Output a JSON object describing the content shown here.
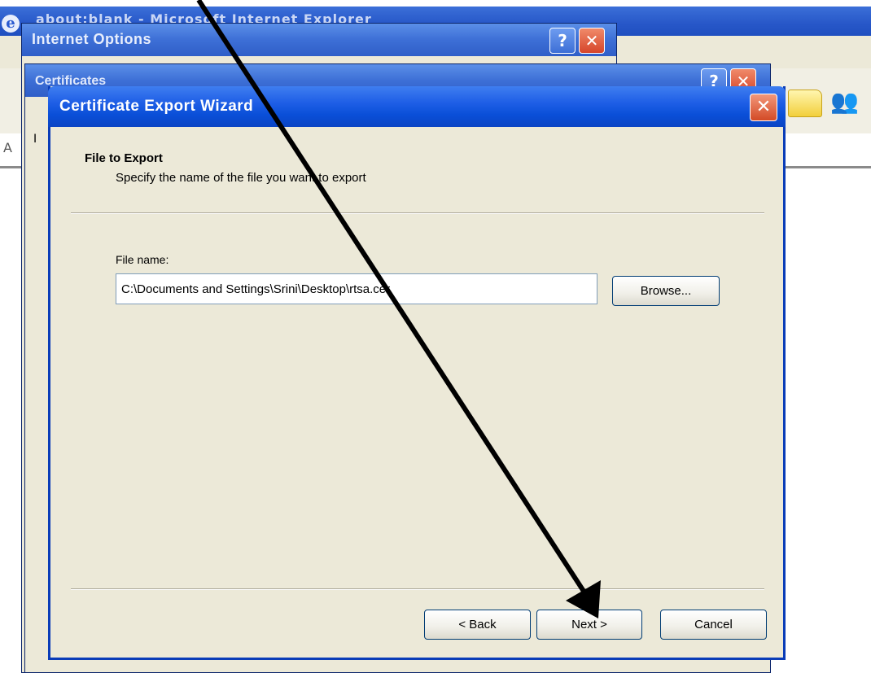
{
  "background_window": {
    "title": "about:blank - Microsoft Internet Explorer",
    "address_letter": "A"
  },
  "internet_options": {
    "title": "Internet Options",
    "help_glyph": "?",
    "close_glyph": "✕"
  },
  "certificates": {
    "title": "Certificates",
    "partial_label": "I",
    "help_glyph": "?",
    "close_glyph": "✕"
  },
  "wizard": {
    "title": "Certificate Export Wizard",
    "close_glyph": "✕",
    "header_title": "File to Export",
    "header_subtitle": "Specify the name of the file you want to export",
    "file_label": "File name:",
    "file_value": "C:\\Documents and Settings\\Srini\\Desktop\\rtsa.cer",
    "browse_label": "Browse...",
    "back_label": "< Back",
    "next_label": "Next >",
    "cancel_label": "Cancel"
  },
  "annotation": {
    "arrow_color": "#000000",
    "points_to": "next-button"
  },
  "icons": [
    "ie-logo-icon",
    "help-icon",
    "close-icon",
    "folder-icon",
    "people-icon",
    "arrow-annotation"
  ]
}
